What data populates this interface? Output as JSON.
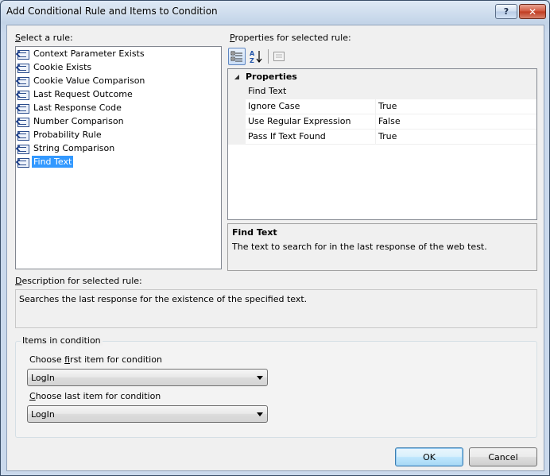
{
  "window": {
    "title": "Add Conditional Rule and Items to Condition",
    "help_glyph": "?",
    "close_glyph": "✕"
  },
  "left": {
    "label_prefix": "",
    "label_underline": "S",
    "label_rest": "elect a rule:",
    "rules": [
      {
        "label": "Context Parameter Exists",
        "selected": false
      },
      {
        "label": "Cookie Exists",
        "selected": false
      },
      {
        "label": "Cookie Value Comparison",
        "selected": false
      },
      {
        "label": "Last Request Outcome",
        "selected": false
      },
      {
        "label": "Last Response Code",
        "selected": false
      },
      {
        "label": "Number Comparison",
        "selected": false
      },
      {
        "label": "Probability Rule",
        "selected": false
      },
      {
        "label": "String Comparison",
        "selected": false
      },
      {
        "label": "Find Text",
        "selected": true
      }
    ]
  },
  "right": {
    "label_underline": "P",
    "label_rest": "roperties for selected rule:",
    "category": "Properties",
    "properties": [
      {
        "name": "Find Text",
        "value": "",
        "selected": true
      },
      {
        "name": "Ignore Case",
        "value": "True",
        "selected": false
      },
      {
        "name": "Use Regular Expression",
        "value": "False",
        "selected": false
      },
      {
        "name": "Pass If Text Found",
        "value": "True",
        "selected": false
      }
    ],
    "help_title": "Find Text",
    "help_desc": "The text to search for in the last response of the web test."
  },
  "description": {
    "label_underline": "D",
    "label_rest": "escription for selected rule:",
    "text": "Searches the last response for the existence of the specified text."
  },
  "items": {
    "legend": "Items in condition",
    "first_label_pre": "Choose ",
    "first_label_underline": "f",
    "first_label_rest": "irst item for condition",
    "first_value": "LogIn",
    "last_label_underline": "C",
    "last_label_rest": "hoose last item for condition",
    "last_value": "LogIn"
  },
  "buttons": {
    "ok": "OK",
    "cancel": "Cancel"
  },
  "colors": {
    "selection": "#3399ff",
    "window_frame": "#cfdced"
  }
}
